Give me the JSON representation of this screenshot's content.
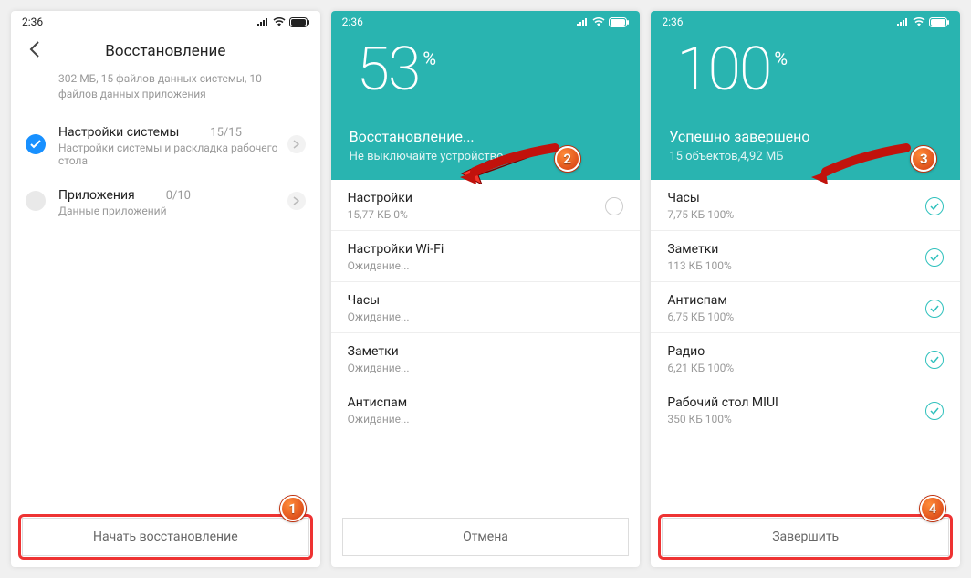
{
  "status": {
    "time": "2:36"
  },
  "screen1": {
    "title": "Восстановление",
    "summary": "302 МБ, 15 файлов данных системы, 10 файлов данных приложения",
    "rows": [
      {
        "title": "Настройки системы",
        "count": "15/15",
        "sub": "Настройки системы и раскладка рабочего стола",
        "checked": true
      },
      {
        "title": "Приложения",
        "count": "0/10",
        "sub": "Данные приложений",
        "checked": false
      }
    ],
    "button": "Начать восстановление"
  },
  "screen2": {
    "percent": "53",
    "title": "Восстановление...",
    "sub": "Не выключайте устройство",
    "items": [
      {
        "title": "Настройки",
        "sub": "15,77 КБ 0%",
        "state": "progress"
      },
      {
        "title": "Настройки Wi-Fi",
        "sub": "Ожидание...",
        "state": "wait"
      },
      {
        "title": "Часы",
        "sub": "Ожидание...",
        "state": "wait"
      },
      {
        "title": "Заметки",
        "sub": "Ожидание...",
        "state": "wait"
      },
      {
        "title": "Антиспам",
        "sub": "Ожидание...",
        "state": "wait"
      }
    ],
    "button": "Отмена"
  },
  "screen3": {
    "percent": "100",
    "title": "Успешно завершено",
    "sub": "15 объектов,4,92 МБ",
    "items": [
      {
        "title": "Часы",
        "sub": "7,75 КБ 100%"
      },
      {
        "title": "Заметки",
        "sub": "113 КБ 100%"
      },
      {
        "title": "Антиспам",
        "sub": "6,75 КБ 100%"
      },
      {
        "title": "Радио",
        "sub": "6,21 КБ 100%"
      },
      {
        "title": "Рабочий стол MIUI",
        "sub": "350 КБ 100%"
      }
    ],
    "button": "Завершить"
  },
  "markers": {
    "b1": "1",
    "b2": "2",
    "b3": "3",
    "b4": "4"
  }
}
